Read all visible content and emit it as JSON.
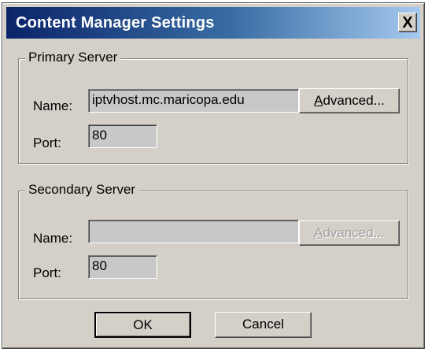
{
  "window": {
    "title": "Content Manager Settings",
    "close_glyph": "X"
  },
  "primary": {
    "legend": "Primary Server",
    "name_label": "Name:",
    "name_value": "iptvhost.mc.maricopa.edu",
    "port_label": "Port:",
    "port_value": "80",
    "advanced_label_first": "A",
    "advanced_label_rest": "dvanced..."
  },
  "secondary": {
    "legend": "Secondary Server",
    "name_label": "Name:",
    "name_value": "",
    "port_label": "Port:",
    "port_value": "80",
    "advanced_label_first": "A",
    "advanced_label_rest": "dvanced..."
  },
  "buttons": {
    "ok": "OK",
    "cancel": "Cancel"
  },
  "colors": {
    "face": "#d4d0c8",
    "title_start": "#0a246a",
    "title_end": "#a6caf0"
  },
  "icons": {
    "close": "close-icon"
  }
}
